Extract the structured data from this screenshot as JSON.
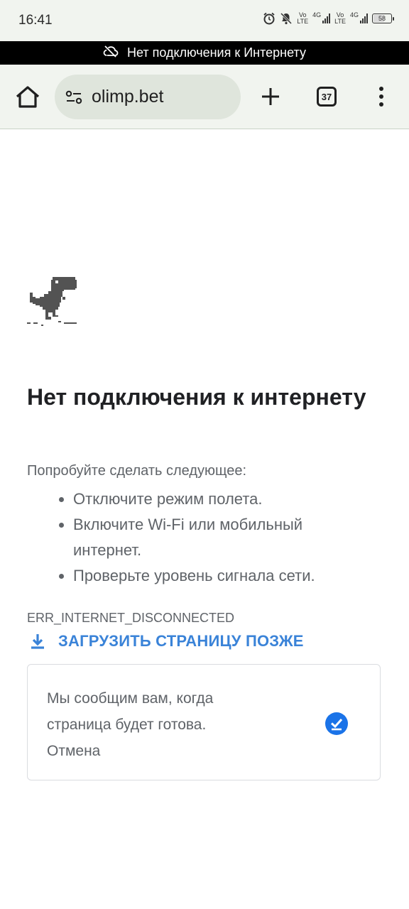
{
  "status_bar": {
    "time": "16:41",
    "network_1": {
      "top": "Vo",
      "bottom": "LTE"
    },
    "network_2_gen": "4G",
    "network_3": {
      "top": "Vo",
      "bottom": "LTE"
    },
    "network_4_gen": "4G",
    "battery": "58"
  },
  "offline_banner": {
    "text": "Нет подключения к Интернету",
    "icon": "cloud-off-icon"
  },
  "toolbar": {
    "url": "olimp.bet",
    "tab_count": "37",
    "icons": [
      "home-icon",
      "site-settings-icon",
      "plus-icon",
      "tabs-icon",
      "more-vert-icon"
    ]
  },
  "content": {
    "title": "Нет подключения к интернету",
    "suggest_intro": "Попробуйте сделать следующее:",
    "suggestions": [
      "Отключите режим полета.",
      "Включите Wi-Fi или мобильный интернет.",
      "Проверьте уровень сигнала сети."
    ],
    "error_code": "ERR_INTERNET_DISCONNECTED",
    "download_later": "ЗАГРУЗИТЬ СТРАНИЦУ ПОЗЖЕ",
    "notify_text": "Мы сообщим вам, когда страница будет готова.",
    "cancel": "Отмена"
  },
  "colors": {
    "accent": "#3a83d8",
    "check_badge": "#1a73e8",
    "toolbar_bg": "#f1f4ef"
  }
}
